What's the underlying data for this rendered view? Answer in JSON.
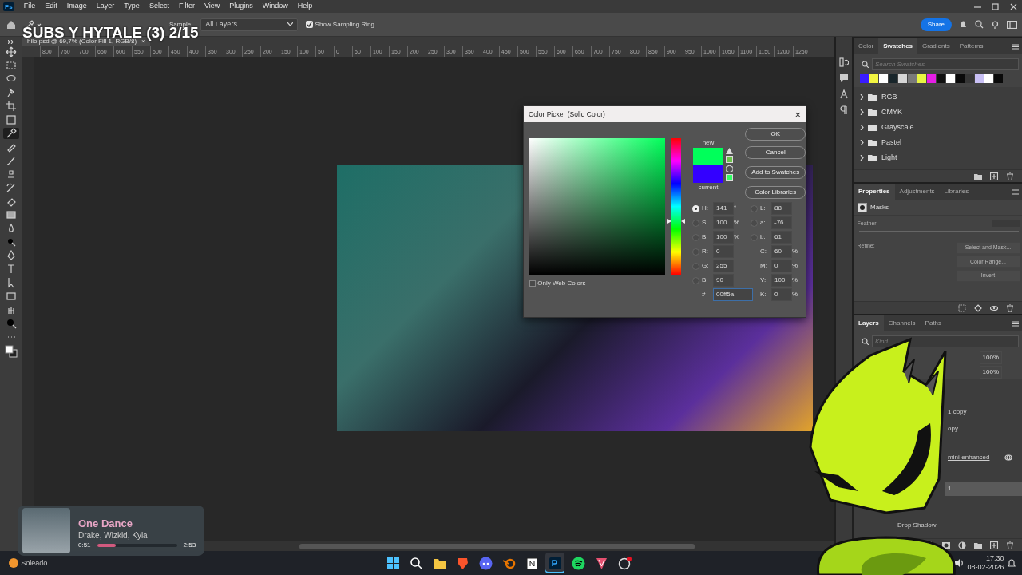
{
  "app_logo": "Ps",
  "menu": [
    "File",
    "Edit",
    "Image",
    "Layer",
    "Type",
    "Select",
    "Filter",
    "View",
    "Plugins",
    "Window",
    "Help"
  ],
  "overlay_title": "SUBS Y HYTALE (3) 2/15",
  "options_bar": {
    "sample_label": "Sample:",
    "sample": "All Layers",
    "sampling_ring": {
      "label": "Show Sampling Ring",
      "checked": true
    },
    "share": "Share"
  },
  "tools": [
    {
      "selected": false
    },
    {
      "selected": false
    },
    {
      "selected": false
    },
    {
      "selected": false
    },
    {
      "selected": false
    },
    {
      "selected": false
    },
    {
      "selected": true
    },
    {
      "selected": false
    },
    {
      "selected": false
    },
    {
      "selected": false
    },
    {
      "selected": false
    },
    {
      "selected": false
    },
    {
      "selected": false
    },
    {
      "selected": false
    },
    {
      "selected": false
    },
    {
      "selected": false
    },
    {
      "selected": false
    },
    {
      "selected": false
    },
    {
      "selected": false
    },
    {
      "selected": false
    },
    {
      "selected": false
    },
    {
      "selected": false
    }
  ],
  "document_tab": {
    "title": "hilo.psd @ 69,7% (Color Fill 1, RGB/8)",
    "close": "×"
  },
  "ruler": [
    "800",
    "750",
    "700",
    "650",
    "600",
    "550",
    "500",
    "450",
    "400",
    "350",
    "300",
    "250",
    "200",
    "150",
    "100",
    "50",
    "0",
    "50",
    "100",
    "150",
    "200",
    "250",
    "300",
    "350",
    "400",
    "450",
    "500",
    "550",
    "600",
    "650",
    "700",
    "750",
    "800",
    "850",
    "900",
    "950",
    "1000",
    "1050",
    "1100",
    "1150",
    "1200",
    "1250"
  ],
  "color_picker": {
    "title": "Color Picker (Solid Color)",
    "close": "×",
    "hue_slider": {
      "level": 0.39
    },
    "preview": [
      {
        "label": "new",
        "color": "#00ff5a"
      },
      {
        "label": "current",
        "color": "#3300ff"
      }
    ],
    "buttons": [
      "OK",
      "Cancel",
      "Add to Swatches",
      "Color Libraries"
    ],
    "fields_left": [
      {
        "kind": "radio",
        "label": "H:",
        "value": "141",
        "unit": "°",
        "selected": true
      },
      {
        "kind": "radio",
        "label": "S:",
        "value": "100",
        "unit": "%",
        "selected": false
      },
      {
        "kind": "radio",
        "label": "B:",
        "value": "100",
        "unit": "%",
        "selected": false
      },
      {
        "kind": "radio",
        "label": "R:",
        "value": "0",
        "selected": false
      },
      {
        "kind": "radio",
        "label": "G:",
        "value": "255",
        "selected": false
      },
      {
        "kind": "radio",
        "label": "B:",
        "value": "90",
        "selected": false
      },
      {
        "kind": "hex",
        "label": "#",
        "value": "00ff5a"
      }
    ],
    "fields_right": [
      {
        "kind": "radio",
        "label": "L:",
        "value": "88",
        "selected": false
      },
      {
        "kind": "radio",
        "label": "a:",
        "value": "-76",
        "selected": false
      },
      {
        "kind": "radio",
        "label": "b:",
        "value": "61",
        "selected": false
      },
      {
        "kind": "plain",
        "label": "C:",
        "value": "60",
        "unit": "%"
      },
      {
        "kind": "plain",
        "label": "M:",
        "value": "0",
        "unit": "%"
      },
      {
        "kind": "plain",
        "label": "Y:",
        "value": "100",
        "unit": "%"
      },
      {
        "kind": "plain",
        "label": "K:",
        "value": "0",
        "unit": "%"
      }
    ],
    "web_colors": {
      "label": "Only Web Colors",
      "checked": false
    }
  },
  "swatches_panel": {
    "tabs": [
      {
        "label": "Color",
        "selected": false
      },
      {
        "label": "Swatches",
        "selected": true
      },
      {
        "label": "Gradients",
        "selected": false
      },
      {
        "label": "Patterns",
        "selected": false
      }
    ],
    "search": {
      "placeholder": "Search Swatches"
    },
    "swatches": [
      {
        "color": "#3a1cff"
      },
      {
        "color": "#f2f542"
      },
      {
        "color": "#ffffff"
      },
      {
        "color": "#18252a"
      },
      {
        "color": "#d6d6d6"
      },
      {
        "color": "#7a7a7a"
      },
      {
        "color": "#e8f542"
      },
      {
        "color": "#e61ee6"
      },
      {
        "color": "#111111"
      },
      {
        "color": "#ffffff"
      },
      {
        "color": "#0a0a0a"
      },
      {
        "color": "#363636"
      },
      {
        "color": "#c9c0f5"
      },
      {
        "color": "#ffffff"
      },
      {
        "color": "#0a0a0a"
      }
    ],
    "groups": [
      {
        "name": "RGB",
        "expanded": false
      },
      {
        "name": "CMYK",
        "expanded": false
      },
      {
        "name": "Grayscale",
        "expanded": false
      },
      {
        "name": "Pastel",
        "expanded": false
      },
      {
        "name": "Light",
        "expanded": false
      }
    ]
  },
  "properties_panel": {
    "tabs": [
      {
        "label": "Properties",
        "selected": true
      },
      {
        "label": "Adjustments",
        "selected": false
      },
      {
        "label": "Libraries",
        "selected": false
      }
    ],
    "section": "Masks",
    "feather_label": "Feather:",
    "refine_label": "Refine:",
    "buttons": [
      "Select and Mask...",
      "Color Range...",
      "Invert"
    ]
  },
  "layers_panel": {
    "tabs": [
      {
        "label": "Layers",
        "selected": true
      },
      {
        "label": "Channels",
        "selected": false
      },
      {
        "label": "Paths",
        "selected": false
      }
    ],
    "search": {
      "placeholder": "Kind"
    },
    "opacity": "100%",
    "fill": "100%",
    "rows": [
      {
        "kind": "layer",
        "name": "1 copy",
        "selected": false
      },
      {
        "kind": "layer",
        "name": "opy",
        "selected": false
      },
      {
        "kind": "smart",
        "name": "mini-enhanced",
        "selected": false
      },
      {
        "kind": "layer",
        "name": "1",
        "selected": true
      },
      {
        "kind": "effect",
        "name": "Drop Shadow",
        "selected": false
      }
    ]
  },
  "music": {
    "title": "One Dance",
    "artist": "Drake, Wizkid, Kyla",
    "elapsed": "0:51",
    "level": 0.23,
    "duration": "2:53"
  },
  "taskbar": {
    "weather": "Soleado",
    "apps": [
      {
        "selected": false
      },
      {
        "selected": false
      },
      {
        "selected": false
      },
      {
        "selected": false
      },
      {
        "selected": false
      },
      {
        "selected": false
      },
      {
        "selected": false
      },
      {
        "selected": true
      },
      {
        "selected": false
      },
      {
        "selected": false
      },
      {
        "selected": false
      }
    ],
    "time": "17:30",
    "date": "08-02-2026"
  }
}
